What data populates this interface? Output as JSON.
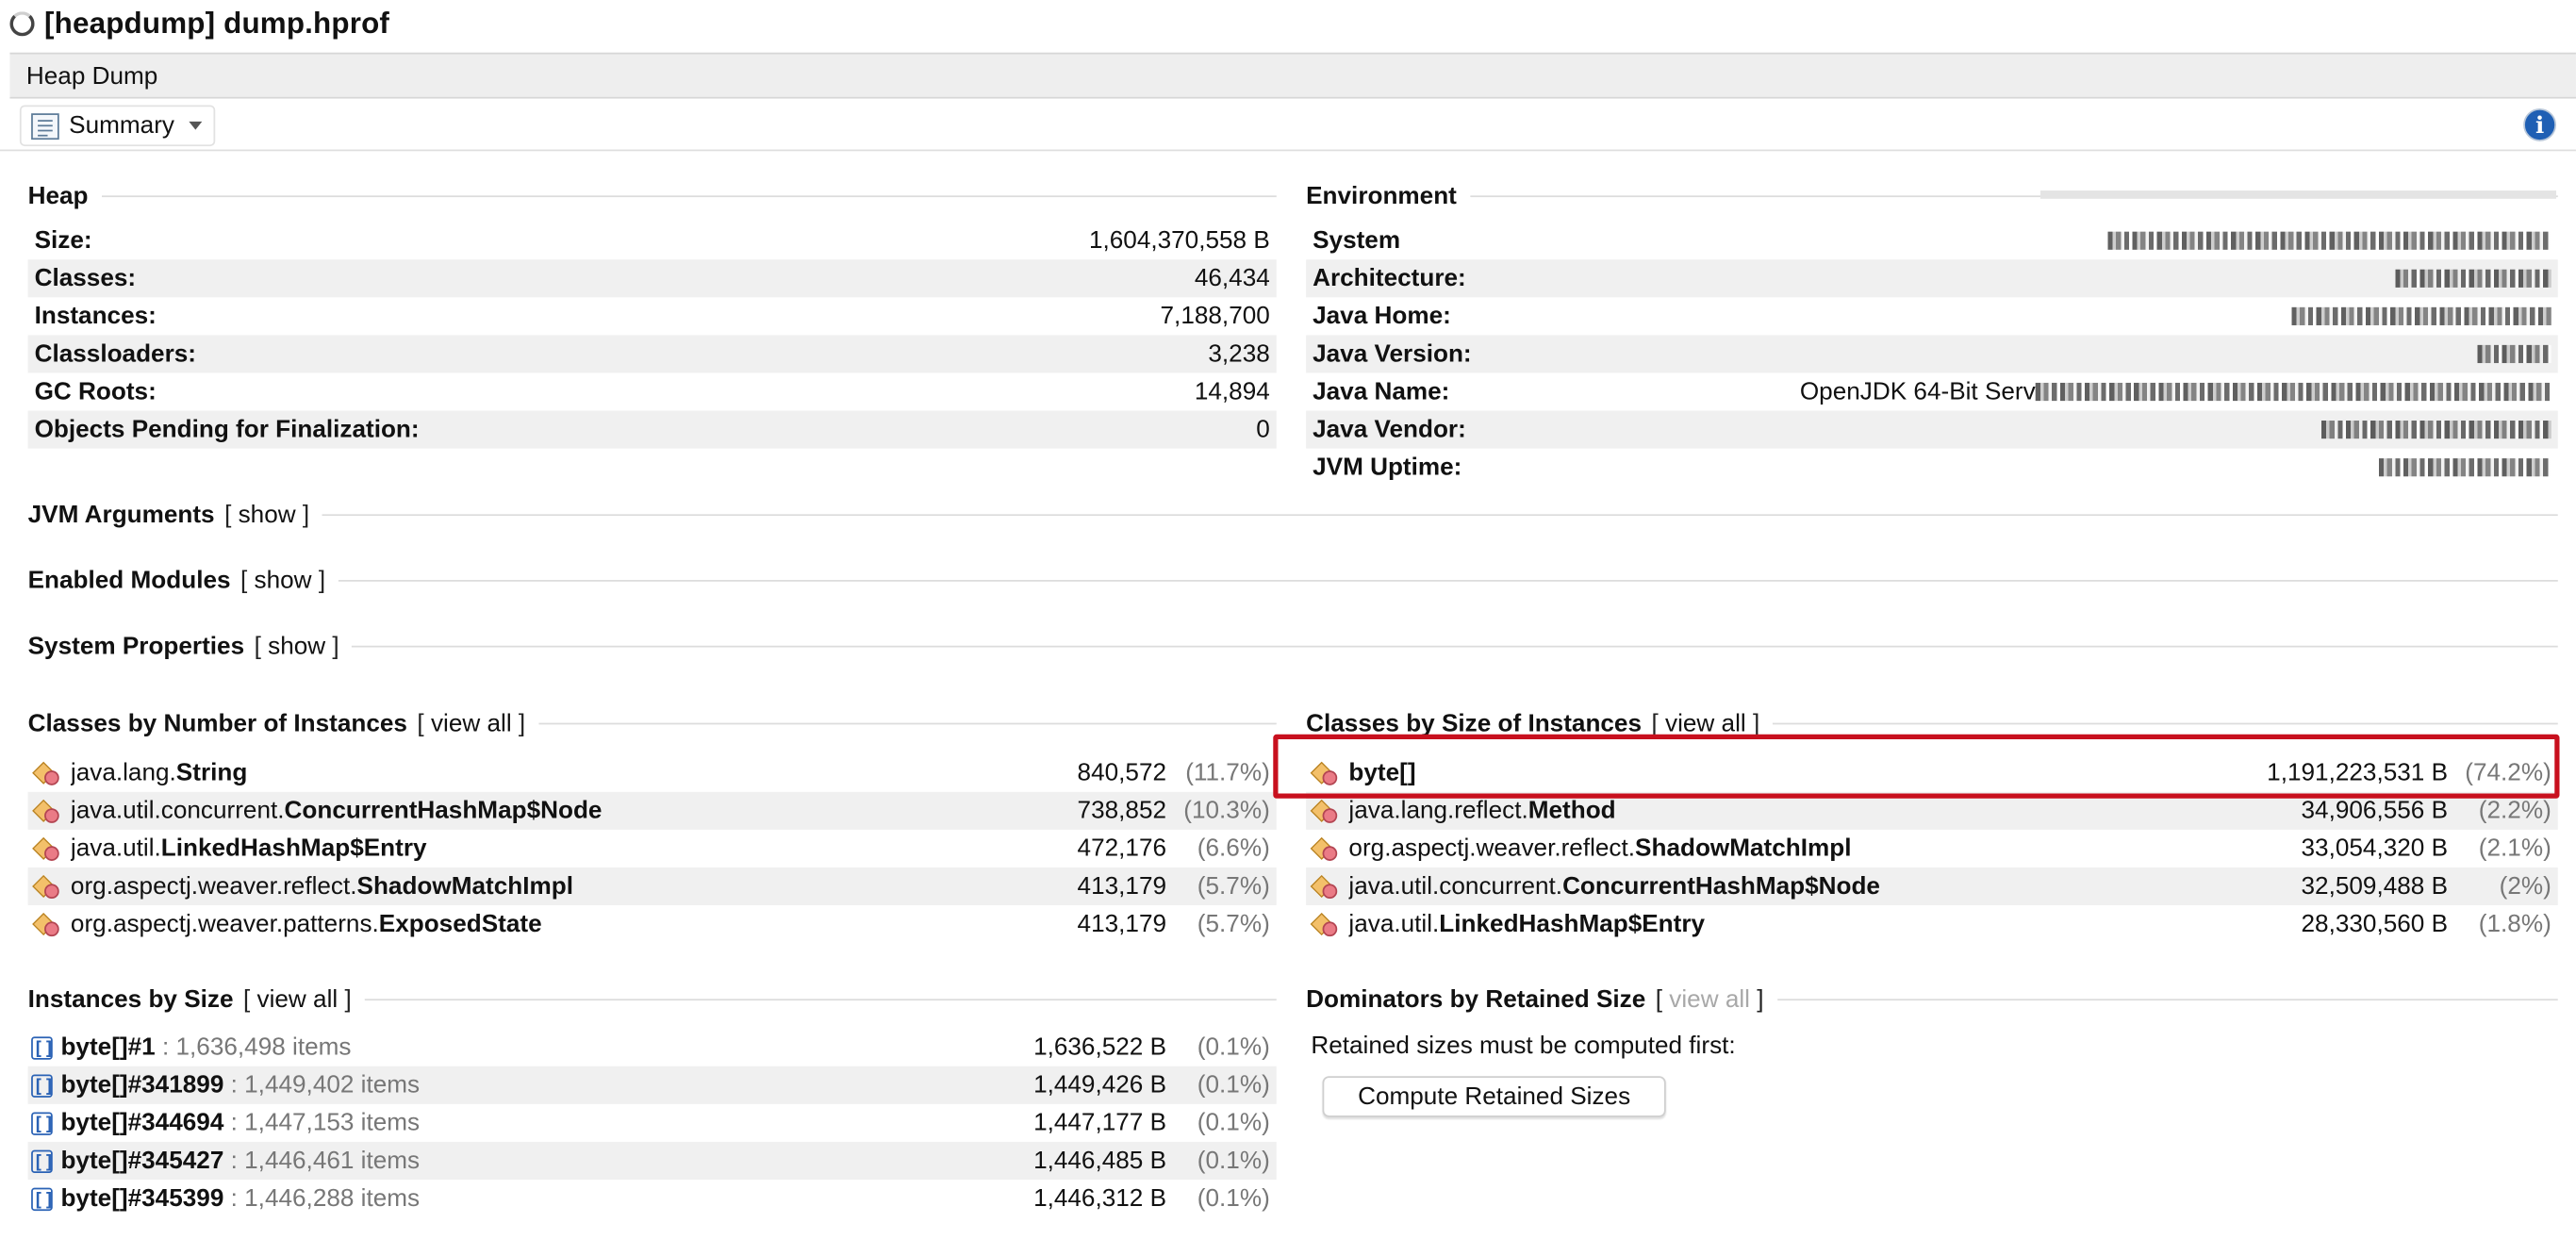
{
  "window": {
    "title": "[heapdump] dump.hprof"
  },
  "tab": {
    "label": "Heap Dump"
  },
  "toolbar": {
    "view_label": "Summary",
    "info_icon": "info-icon"
  },
  "heap": {
    "title": "Heap",
    "rows": [
      {
        "label": "Size:",
        "value": "1,604,370,558 B"
      },
      {
        "label": "Classes:",
        "value": "46,434"
      },
      {
        "label": "Instances:",
        "value": "7,188,700"
      },
      {
        "label": "Classloaders:",
        "value": "3,238"
      },
      {
        "label": "GC Roots:",
        "value": "14,894"
      },
      {
        "label": "Objects Pending for Finalization:",
        "value": "0"
      }
    ]
  },
  "environment": {
    "title": "Environment",
    "rows": [
      {
        "label": "System",
        "value": ""
      },
      {
        "label": "Architecture:",
        "value": ""
      },
      {
        "label": "Java Home:",
        "value": ""
      },
      {
        "label": "Java Version:",
        "value": ""
      },
      {
        "label": "Java Name:",
        "value": "OpenJDK 64-Bit Serv"
      },
      {
        "label": "Java Vendor:",
        "value": ""
      },
      {
        "label": "JVM Uptime:",
        "value": ""
      }
    ]
  },
  "collapsed_sections": [
    {
      "title": "JVM Arguments",
      "link": "show"
    },
    {
      "title": "Enabled Modules",
      "link": "show"
    },
    {
      "title": "System Properties",
      "link": "show"
    }
  ],
  "classes_by_count": {
    "title": "Classes by Number of Instances",
    "link": "view all",
    "rows": [
      {
        "package": "java.lang.",
        "class": "String",
        "count": "840,572",
        "percent": "(11.7%)"
      },
      {
        "package": "java.util.concurrent.",
        "class": "ConcurrentHashMap$Node",
        "count": "738,852",
        "percent": "(10.3%)"
      },
      {
        "package": "java.util.",
        "class": "LinkedHashMap$Entry",
        "count": "472,176",
        "percent": "(6.6%)"
      },
      {
        "package": "org.aspectj.weaver.reflect.",
        "class": "ShadowMatchImpl",
        "count": "413,179",
        "percent": "(5.7%)"
      },
      {
        "package": "org.aspectj.weaver.patterns.",
        "class": "ExposedState",
        "count": "413,179",
        "percent": "(5.7%)"
      }
    ]
  },
  "classes_by_size": {
    "title": "Classes by Size of Instances",
    "link": "view all",
    "rows": [
      {
        "package": "",
        "class": "byte[]",
        "size": "1,191,223,531 B",
        "percent": "(74.2%)"
      },
      {
        "package": "java.lang.reflect.",
        "class": "Method",
        "size": "34,906,556 B",
        "percent": "(2.2%)"
      },
      {
        "package": "org.aspectj.weaver.reflect.",
        "class": "ShadowMatchImpl",
        "size": "33,054,320 B",
        "percent": "(2.1%)"
      },
      {
        "package": "java.util.concurrent.",
        "class": "ConcurrentHashMap$Node",
        "size": "32,509,488 B",
        "percent": "(2%)"
      },
      {
        "package": "java.util.",
        "class": "LinkedHashMap$Entry",
        "size": "28,330,560 B",
        "percent": "(1.8%)"
      }
    ]
  },
  "instances_by_size": {
    "title": "Instances by Size",
    "link": "view all",
    "rows": [
      {
        "name": "byte[]#1",
        "items": ": 1,636,498 items",
        "size": "1,636,522 B",
        "percent": "(0.1%)"
      },
      {
        "name": "byte[]#341899",
        "items": ": 1,449,402 items",
        "size": "1,449,426 B",
        "percent": "(0.1%)"
      },
      {
        "name": "byte[]#344694",
        "items": ": 1,447,153 items",
        "size": "1,447,177 B",
        "percent": "(0.1%)"
      },
      {
        "name": "byte[]#345427",
        "items": ": 1,446,461 items",
        "size": "1,446,485 B",
        "percent": "(0.1%)"
      },
      {
        "name": "byte[]#345399",
        "items": ": 1,446,288 items",
        "size": "1,446,312 B",
        "percent": "(0.1%)"
      }
    ]
  },
  "dominators": {
    "title": "Dominators by Retained Size",
    "link": "view all",
    "note": "Retained sizes must be computed first:",
    "button_label": "Compute Retained Sizes"
  },
  "colors": {
    "highlight": "#c8101e",
    "stripe": "#f0f0f0",
    "muted": "#777777"
  }
}
